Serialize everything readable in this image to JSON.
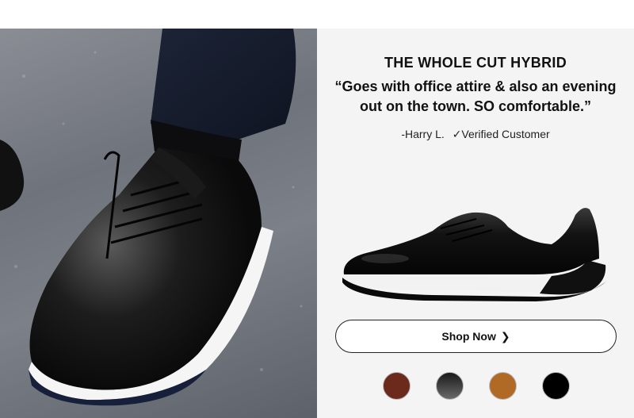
{
  "hero": {
    "title": "THE WHOLE CUT HYBRID",
    "quote_line1": "“Goes with office attire & also an evening",
    "quote_line2": "out on the town. SO comfortable.”",
    "reviewer": "-Harry L.",
    "verified": "✓Verified Customer"
  },
  "shop_button": {
    "label": "Shop Now",
    "icon": "chevron-right-icon"
  },
  "swatches": [
    {
      "name": "brown",
      "color": "#6b2a1c"
    },
    {
      "name": "black-gradient",
      "color": "#3a3a3a"
    },
    {
      "name": "tan",
      "color": "#b06a25"
    },
    {
      "name": "black",
      "color": "#000000"
    }
  ],
  "colors": {
    "panel_bg": "#f4f4f4",
    "button_border": "#222222"
  }
}
